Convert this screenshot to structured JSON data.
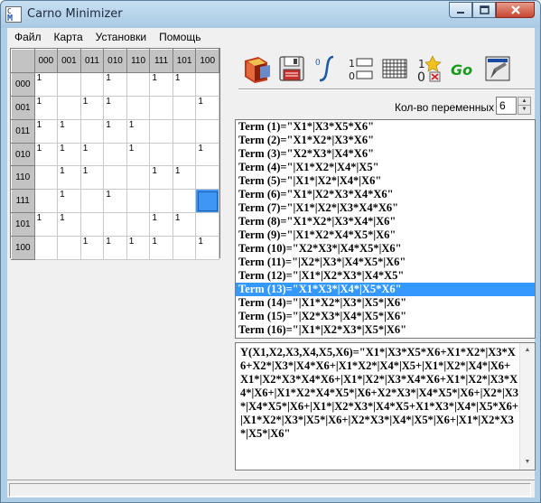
{
  "window": {
    "title": "Carno Minimizer",
    "icon_letters": [
      "C",
      "M"
    ]
  },
  "menu": [
    "Файл",
    "Карта",
    "Установки",
    "Помощь"
  ],
  "kmap": {
    "col_headers": [
      "000",
      "001",
      "011",
      "010",
      "110",
      "111",
      "101",
      "100"
    ],
    "row_headers": [
      "000",
      "001",
      "011",
      "010",
      "110",
      "111",
      "101",
      "100"
    ],
    "cells": [
      [
        "1",
        "",
        "",
        "1",
        "",
        "1",
        "1",
        ""
      ],
      [
        "1",
        "",
        "1",
        "1",
        "",
        "",
        "",
        "1"
      ],
      [
        "1",
        "1",
        "",
        "1",
        "1",
        "",
        "",
        ""
      ],
      [
        "1",
        "1",
        "1",
        "",
        "1",
        "",
        "",
        "1"
      ],
      [
        "",
        "1",
        "1",
        "",
        "",
        "1",
        "1",
        ""
      ],
      [
        "",
        "1",
        "",
        "1",
        "",
        "",
        "",
        ""
      ],
      [
        "1",
        "1",
        "",
        "",
        "",
        "1",
        "1",
        ""
      ],
      [
        "",
        "",
        "1",
        "1",
        "1",
        "1",
        "",
        "1"
      ]
    ],
    "selected_cell": {
      "row": 5,
      "col": 7
    },
    "highlight_color": "#3f96f5"
  },
  "toolbar": {
    "tools": [
      {
        "name": "open-book-icon"
      },
      {
        "name": "save-floppy-icon"
      },
      {
        "name": "function-integral-icon"
      },
      {
        "name": "binary-list-icon"
      },
      {
        "name": "grid-map-icon"
      },
      {
        "name": "random-binary-icon"
      },
      {
        "name": "go-button",
        "label": "Go"
      },
      {
        "name": "edit-tool-icon"
      }
    ]
  },
  "variables": {
    "label": "Кол-во переменных",
    "value": "6"
  },
  "terms": [
    "Term (1)=\"X1*|X3*X5*X6\"",
    "Term (2)=\"X1*X2*|X3*X6\"",
    "Term (3)=\"X2*X3*|X4*X6\"",
    "Term (4)=\"|X1*X2*|X4*|X5\"",
    "Term (5)=\"|X1*|X2*|X4*|X6\"",
    "Term (6)=\"X1*|X2*X3*X4*X6\"",
    "Term (7)=\"|X1*|X2*|X3*X4*X6\"",
    "Term (8)=\"X1*X2*|X3*X4*|X6\"",
    "Term (9)=\"|X1*X2*X4*X5*|X6\"",
    "Term (10)=\"X2*X3*|X4*X5*|X6\"",
    "Term (11)=\"|X2*|X3*|X4*X5*|X6\"",
    "Term (12)=\"|X1*|X2*X3*|X4*X5\"",
    "Term (13)=\"X1*X3*|X4*|X5*X6\"",
    "Term (14)=\"|X1*X2*|X3*|X5*|X6\"",
    "Term (15)=\"|X2*X3*|X4*|X5*|X6\"",
    "Term (16)=\"|X1*|X2*X3*|X5*|X6\""
  ],
  "selected_term_index": 12,
  "result": "Y(X1,X2,X3,X4,X5,X6)=\"X1*|X3*X5*X6+X1*X2*|X3*X6+X2*|X3*|X4*X6+|X1*X2*|X4*|X5+|X1*|X2*|X4*|X6+X1*|X2*X3*X4*X6+|X1*|X2*|X3*X4*X6+X1*|X2*|X3*X4*|X6+|X1*X2*X4*X5*|X6+X2*X3*|X4*X5*|X6+|X2*|X3*|X4*X5*|X6+|X1*|X2*X3*|X4*X5+X1*X3*|X4*|X5*X6+|X1*X2*|X3*|X5*|X6+|X2*X3*|X4*|X5*|X6+|X1*|X2*X3*|X5*|X6\""
}
